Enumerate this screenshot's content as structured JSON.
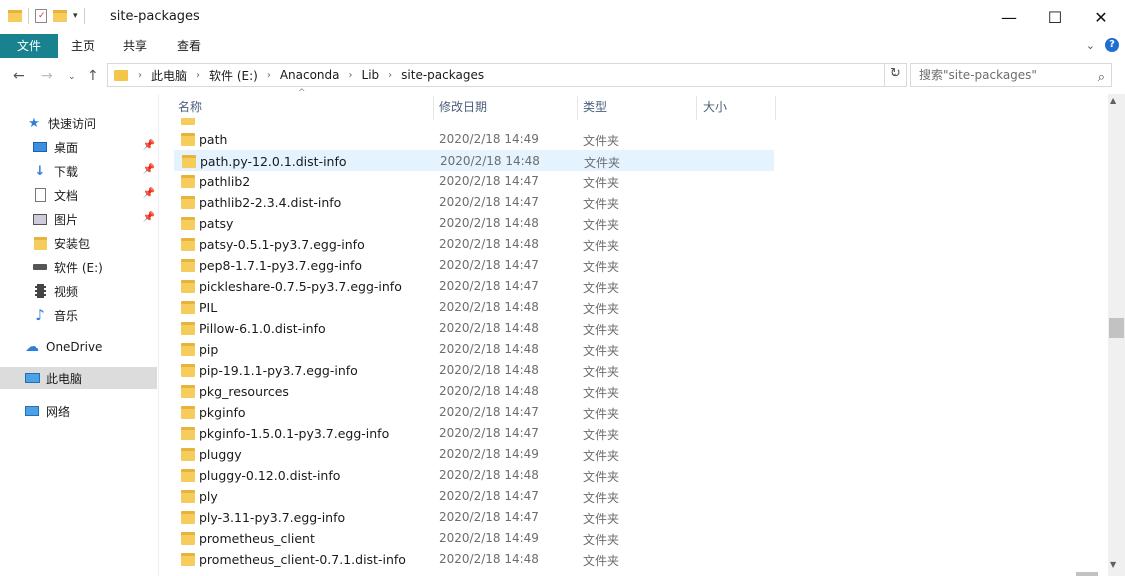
{
  "window": {
    "title": "site-packages",
    "minimize_glyph": "—",
    "maximize_glyph": "☐",
    "close_glyph": "✕"
  },
  "ribbon": {
    "tabs": [
      "文件",
      "主页",
      "共享",
      "查看"
    ]
  },
  "address": {
    "breadcrumbs": [
      "此电脑",
      "软件 (E:)",
      "Anaconda",
      "Lib",
      "site-packages"
    ],
    "search_placeholder": "搜索\"site-packages\""
  },
  "sidebar": {
    "items": [
      {
        "label": "快速访问",
        "icon": "star-icon"
      },
      {
        "label": "桌面",
        "icon": "desktop-icon",
        "pinned": true
      },
      {
        "label": "下载",
        "icon": "download-icon",
        "pinned": true
      },
      {
        "label": "文档",
        "icon": "document-icon",
        "pinned": true
      },
      {
        "label": "图片",
        "icon": "picture-icon",
        "pinned": true
      },
      {
        "label": "安装包",
        "icon": "folder-icon"
      },
      {
        "label": "软件 (E:)",
        "icon": "drive-icon"
      },
      {
        "label": "视频",
        "icon": "video-icon"
      },
      {
        "label": "音乐",
        "icon": "music-icon"
      },
      {
        "label": "OneDrive",
        "icon": "cloud-icon"
      },
      {
        "label": "此电脑",
        "icon": "computer-icon",
        "selected": true
      },
      {
        "label": "网络",
        "icon": "network-icon"
      }
    ]
  },
  "columns": {
    "name": "名称",
    "date": "修改日期",
    "type": "类型",
    "size": "大小"
  },
  "files": [
    {
      "name": "path",
      "date": "2020/2/18 14:49",
      "type": "文件夹"
    },
    {
      "name": "path.py-12.0.1.dist-info",
      "date": "2020/2/18 14:48",
      "type": "文件夹",
      "selected": true
    },
    {
      "name": "pathlib2",
      "date": "2020/2/18 14:47",
      "type": "文件夹"
    },
    {
      "name": "pathlib2-2.3.4.dist-info",
      "date": "2020/2/18 14:47",
      "type": "文件夹"
    },
    {
      "name": "patsy",
      "date": "2020/2/18 14:48",
      "type": "文件夹"
    },
    {
      "name": "patsy-0.5.1-py3.7.egg-info",
      "date": "2020/2/18 14:48",
      "type": "文件夹"
    },
    {
      "name": "pep8-1.7.1-py3.7.egg-info",
      "date": "2020/2/18 14:47",
      "type": "文件夹"
    },
    {
      "name": "pickleshare-0.7.5-py3.7.egg-info",
      "date": "2020/2/18 14:47",
      "type": "文件夹"
    },
    {
      "name": "PIL",
      "date": "2020/2/18 14:48",
      "type": "文件夹"
    },
    {
      "name": "Pillow-6.1.0.dist-info",
      "date": "2020/2/18 14:48",
      "type": "文件夹"
    },
    {
      "name": "pip",
      "date": "2020/2/18 14:48",
      "type": "文件夹"
    },
    {
      "name": "pip-19.1.1-py3.7.egg-info",
      "date": "2020/2/18 14:48",
      "type": "文件夹"
    },
    {
      "name": "pkg_resources",
      "date": "2020/2/18 14:48",
      "type": "文件夹"
    },
    {
      "name": "pkginfo",
      "date": "2020/2/18 14:47",
      "type": "文件夹"
    },
    {
      "name": "pkginfo-1.5.0.1-py3.7.egg-info",
      "date": "2020/2/18 14:47",
      "type": "文件夹"
    },
    {
      "name": "pluggy",
      "date": "2020/2/18 14:49",
      "type": "文件夹"
    },
    {
      "name": "pluggy-0.12.0.dist-info",
      "date": "2020/2/18 14:48",
      "type": "文件夹"
    },
    {
      "name": "ply",
      "date": "2020/2/18 14:47",
      "type": "文件夹"
    },
    {
      "name": "ply-3.11-py3.7.egg-info",
      "date": "2020/2/18 14:47",
      "type": "文件夹"
    },
    {
      "name": "prometheus_client",
      "date": "2020/2/18 14:49",
      "type": "文件夹"
    },
    {
      "name": "prometheus_client-0.7.1.dist-info",
      "date": "2020/2/18 14:48",
      "type": "文件夹"
    }
  ],
  "colors": {
    "file_tab": "#19828f",
    "selection": "#e5f3ff",
    "folder": "#f6cd5c"
  }
}
